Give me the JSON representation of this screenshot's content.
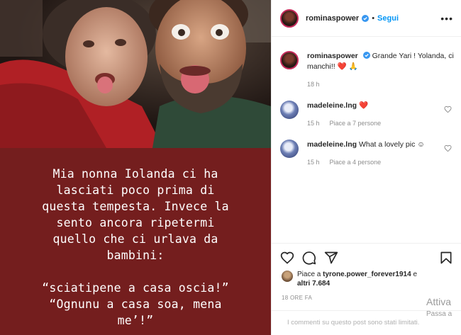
{
  "story": {
    "caption_lines": [
      "Mia nonna Iolanda ci ha",
      "lasciati poco prima di",
      "questa tempesta. Invece la",
      "sento ancora ripetermi",
      "quello che ci urlava da",
      "bambini:",
      "",
      "“sciatipene a casa oscia!”",
      "“Ognunu a casa soa, mena",
      "me’!”"
    ],
    "caption_bg": "#741e1e"
  },
  "header": {
    "username": "rominaspower",
    "separator": "•",
    "follow_label": "Segui",
    "more_label": "•••"
  },
  "comments": [
    {
      "user": "rominaspower",
      "text": "Grande Yari ! Yolanda, ci manchi!! ❤️ 🙏",
      "time": "18 h"
    },
    {
      "user": "madeleine.lng",
      "text": "❤️",
      "time": "15 h",
      "likes": "Piace a 7 persone"
    },
    {
      "user": "madeleine.lng",
      "text": "What a lovely pic ☺",
      "time": "15 h",
      "likes": "Piace a 4 persone"
    }
  ],
  "likes": {
    "prefix": "Piace a",
    "user": "tyrone.power_forever1914",
    "suffix": "e",
    "others": "altri 7.684"
  },
  "post_time": "18 ORE FA",
  "add_comment_text": "I commenti su questo post sono stati limitati.",
  "watermark": {
    "line1": "Attiva",
    "line2": "Passa a"
  },
  "colors": {
    "accent": "#0095f6",
    "verified": "#3897f0",
    "heart": "#ed4956",
    "muted": "#8e8e8e"
  }
}
